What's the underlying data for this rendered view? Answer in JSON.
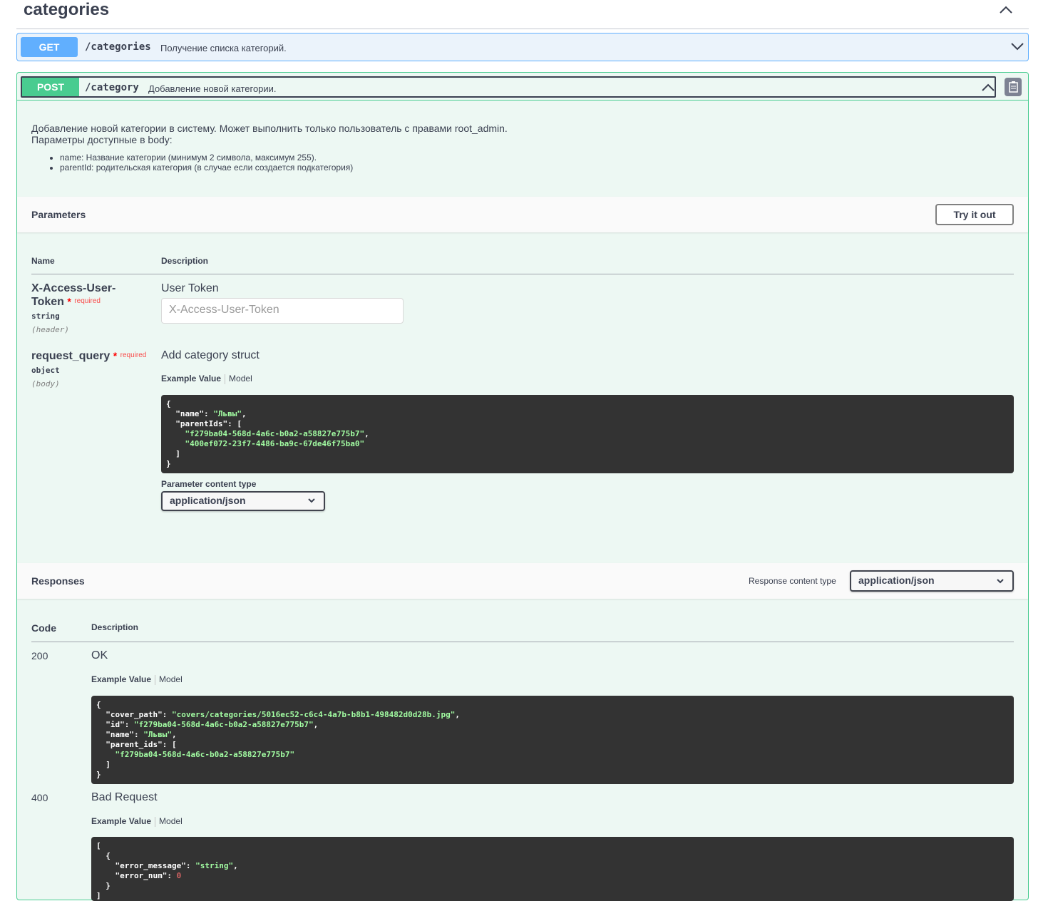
{
  "tag": {
    "title": "categories"
  },
  "get_op": {
    "method": "GET",
    "path": "/categories",
    "summary": "Получение списка категорий."
  },
  "post_op": {
    "method": "POST",
    "path": "/category",
    "summary": "Добавление новой категории.",
    "description_line1": "Добавление новой категории в систему. Может выполнить только пользователь с правами root_admin.",
    "description_line2": "Параметры доступные в body:",
    "bullets": [
      "name: Название категории (минимум 2 символа, максимум 255).",
      "parentId: родительская категория (в случае если создается подкатегория)"
    ]
  },
  "parameters": {
    "title": "Parameters",
    "try_label": "Try it out",
    "col_name": "Name",
    "col_desc": "Description",
    "p1": {
      "name_line1": "X-Access-User-",
      "name_line2": "Token",
      "required_star": "*",
      "required_text": "required",
      "type": "string",
      "in": "(header)",
      "description": "User Token",
      "placeholder": "X-Access-User-Token"
    },
    "p2": {
      "name": "request_query",
      "required_star": "*",
      "required_text": "required",
      "type": "object",
      "in": "(body)",
      "description": "Add category struct",
      "tab_example": "Example Value",
      "tab_model": "Model",
      "example_name": "Львы",
      "example_parent_ids": [
        "f279ba04-568d-4a6c-b0a2-a58827e775b7",
        "400ef072-23f7-4486-ba9c-67de46f75ba0"
      ],
      "content_type_label": "Parameter content type",
      "content_type_value": "application/json"
    }
  },
  "responses": {
    "title": "Responses",
    "content_type_label": "Response content type",
    "content_type_value": "application/json",
    "col_code": "Code",
    "col_desc": "Description",
    "r200": {
      "code": "200",
      "description": "OK",
      "tab_example": "Example Value",
      "tab_model": "Model",
      "cover_path": "covers/categories/5016ec52-c6c4-4a7b-b8b1-498482d0d28b.jpg",
      "id": "f279ba04-568d-4a6c-b0a2-a58827e775b7",
      "name": "Львы",
      "parent_ids": [
        "f279ba04-568d-4a6c-b0a2-a58827e775b7"
      ]
    },
    "r400": {
      "code": "400",
      "description": "Bad Request",
      "tab_example": "Example Value",
      "tab_model": "Model",
      "error_message": "string",
      "error_num": "0"
    }
  },
  "colors": {
    "get": "#61affe",
    "post": "#49cc90",
    "code_bg": "#333333",
    "code_string": "#a2fca2"
  }
}
